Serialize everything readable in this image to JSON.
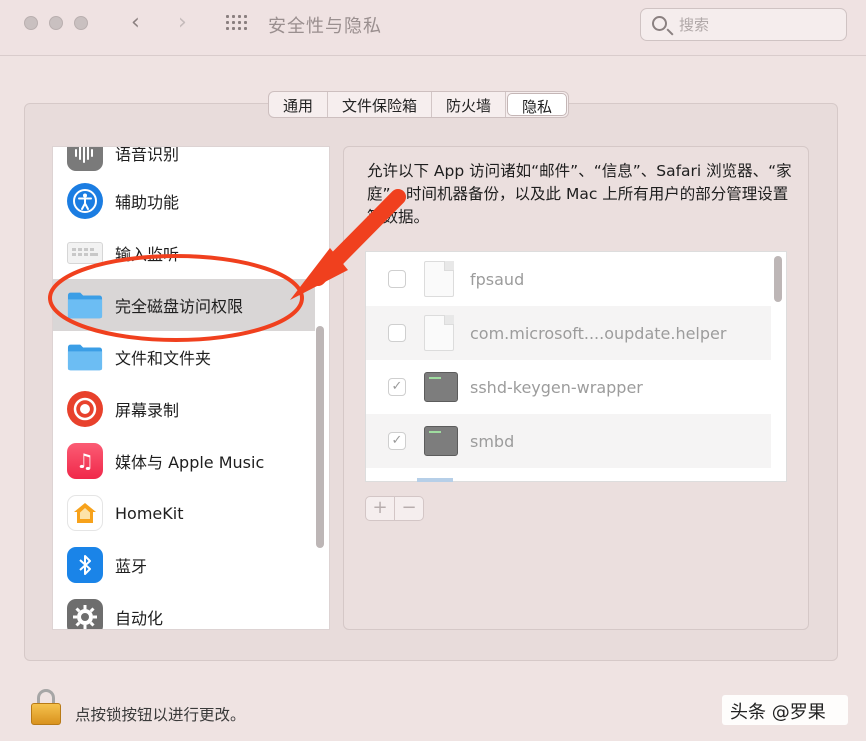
{
  "window": {
    "title": "安全性与隐私",
    "search_placeholder": "搜索"
  },
  "tabs": [
    {
      "label": "通用",
      "active": false
    },
    {
      "label": "文件保险箱",
      "active": false
    },
    {
      "label": "防火墙",
      "active": false
    },
    {
      "label": "隐私",
      "active": true
    }
  ],
  "sidebar": {
    "items": [
      {
        "label": "语音识别",
        "icon": "waveform-icon"
      },
      {
        "label": "辅助功能",
        "icon": "accessibility-icon"
      },
      {
        "label": "输入监听",
        "icon": "keyboard-icon"
      },
      {
        "label": "完全磁盘访问权限",
        "icon": "folder-icon",
        "selected": true
      },
      {
        "label": "文件和文件夹",
        "icon": "folder-icon"
      },
      {
        "label": "屏幕录制",
        "icon": "screen-record-icon"
      },
      {
        "label": "媒体与 Apple Music",
        "icon": "music-icon"
      },
      {
        "label": "HomeKit",
        "icon": "home-icon"
      },
      {
        "label": "蓝牙",
        "icon": "bluetooth-icon"
      },
      {
        "label": "自动化",
        "icon": "gear-icon"
      }
    ]
  },
  "detail": {
    "description": "允许以下 App 访问诸如“邮件”、“信息”、Safari 浏览器、“家庭”、时间机器备份，以及此 Mac 上所有用户的部分管理设置等数据。",
    "apps": [
      {
        "name": "fpsaud",
        "checked": false,
        "icon": "document-icon"
      },
      {
        "name": "com.microsoft....oupdate.helper",
        "checked": false,
        "icon": "document-icon"
      },
      {
        "name": "sshd-keygen-wrapper",
        "checked": true,
        "icon": "terminal-icon"
      },
      {
        "name": "smbd",
        "checked": true,
        "icon": "terminal-icon"
      }
    ],
    "add_label": "+",
    "remove_label": "−",
    "checkmark": "✓"
  },
  "footer": {
    "lock_text": "点按锁按钮以进行更改。"
  },
  "watermark": "头条 @罗果",
  "colors": {
    "annotation_red": "#f0401e",
    "selected_row": "#d9d6d6"
  }
}
